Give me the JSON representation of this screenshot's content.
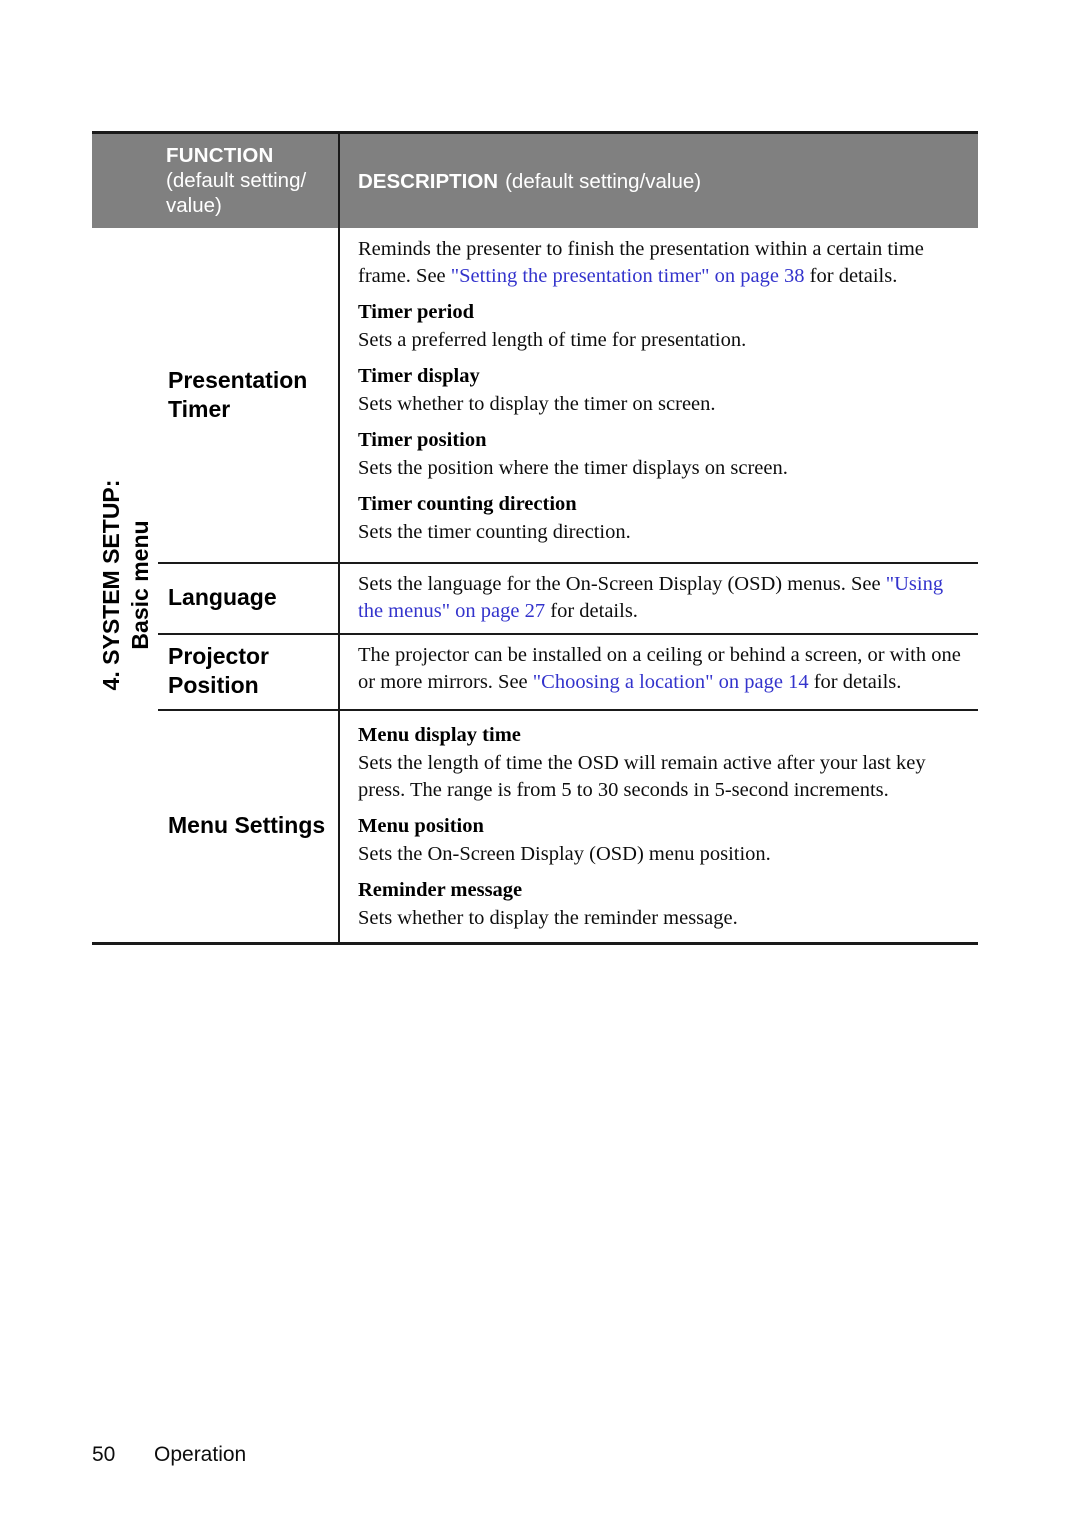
{
  "document": {
    "footer": {
      "page_number": "50",
      "section": "Operation"
    }
  },
  "table": {
    "header": {
      "function_title": "FUNCTION",
      "function_subtitle": "(default setting/ value)",
      "description_title": "DESCRIPTION",
      "description_subtitle": "(default setting/value)"
    },
    "spine": {
      "line1": "4. SYSTEM SETUP:",
      "line2": "Basic menu"
    },
    "rows": [
      {
        "function": "Presentation Timer",
        "intro_prefix": "Reminds the presenter to finish the presentation within a certain time frame. See ",
        "intro_link": "\"Setting the presentation timer\" on page 38",
        "intro_suffix": " for details.",
        "items": [
          {
            "heading": "Timer period",
            "body": "Sets a preferred length of time for presentation."
          },
          {
            "heading": "Timer display",
            "body": "Sets whether to display the timer on screen."
          },
          {
            "heading": "Timer position",
            "body": "Sets the position where the timer displays on screen."
          },
          {
            "heading": "Timer counting direction",
            "body": "Sets the timer counting direction."
          }
        ]
      },
      {
        "function": "Language",
        "body_prefix": "Sets the language for the On-Screen Display (OSD) menus. See ",
        "body_link": "\"Using the menus\" on page 27",
        "body_suffix": " for details."
      },
      {
        "function": "Projector Position",
        "body_prefix": "The projector can be installed on a ceiling or behind a screen, or with one or more mirrors. See ",
        "body_link": "\"Choosing a location\" on page 14",
        "body_suffix": " for details."
      },
      {
        "function": "Menu Settings",
        "items": [
          {
            "heading": "Menu display time",
            "body": "Sets the length of time the OSD will remain active after your last key press. The range is from 5 to 30 seconds in 5-second increments."
          },
          {
            "heading": "Menu position",
            "body": "Sets the On-Screen Display (OSD) menu position."
          },
          {
            "heading": "Reminder message",
            "body": "Sets whether to display the reminder message."
          }
        ]
      }
    ]
  },
  "colors": {
    "header_band": "#808080",
    "rule": "#1a1a1a",
    "link": "#3333cc",
    "text": "#0d0d0d"
  }
}
